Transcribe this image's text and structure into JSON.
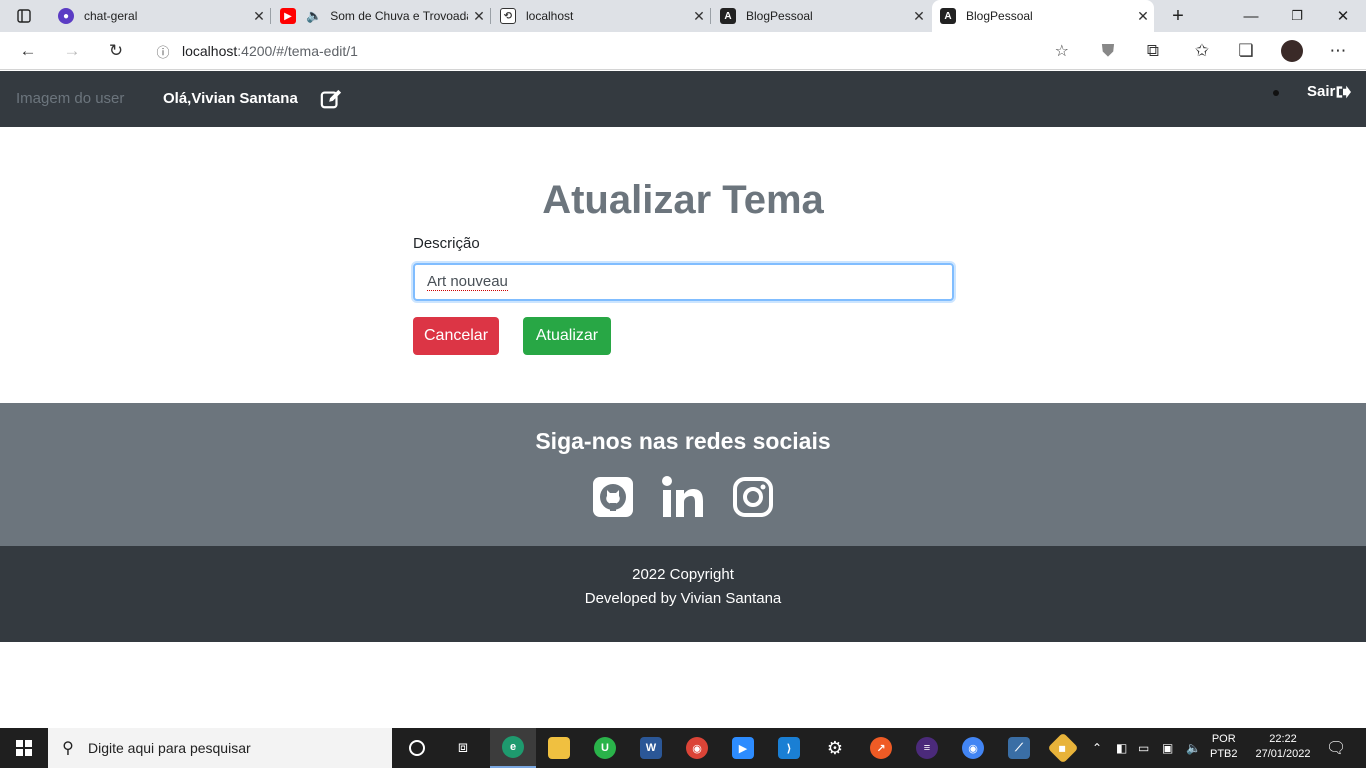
{
  "browser": {
    "tabs": [
      {
        "title": "chat-geral",
        "icon": "chat-icon"
      },
      {
        "title": "Som de Chuva e Trovoada",
        "icon": "youtube-icon"
      },
      {
        "title": "localhost",
        "icon": "page-icon"
      },
      {
        "title": "BlogPessoal",
        "icon": "angular-icon"
      },
      {
        "title": "BlogPessoal",
        "icon": "angular-icon",
        "active": true
      }
    ],
    "url_host": "localhost",
    "url_path": ":4200/#/tema-edit/1"
  },
  "navbar": {
    "user_image_alt": "Imagem do user",
    "greeting": "Olá,Vivian Santana",
    "logout_label": "Sair"
  },
  "form": {
    "title": "Atualizar Tema",
    "field_label": "Descrição",
    "field_value": "Art nouveau",
    "cancel_label": "Cancelar",
    "submit_label": "Atualizar"
  },
  "footer": {
    "social_heading": "Siga-nos nas redes sociais",
    "social_icons": [
      "github-icon",
      "linkedin-icon",
      "instagram-icon"
    ],
    "copyright": "2022 Copyright",
    "developer": "Developed by Vivian Santana"
  },
  "taskbar": {
    "search_placeholder": "Digite aqui para pesquisar",
    "lang_top": "POR",
    "lang_bottom": "PTB2",
    "time": "22:22",
    "date": "27/01/2022"
  },
  "colors": {
    "navbar": "#343a40",
    "social_bg": "#6c757d",
    "danger": "#dc3545",
    "success": "#28a745"
  }
}
